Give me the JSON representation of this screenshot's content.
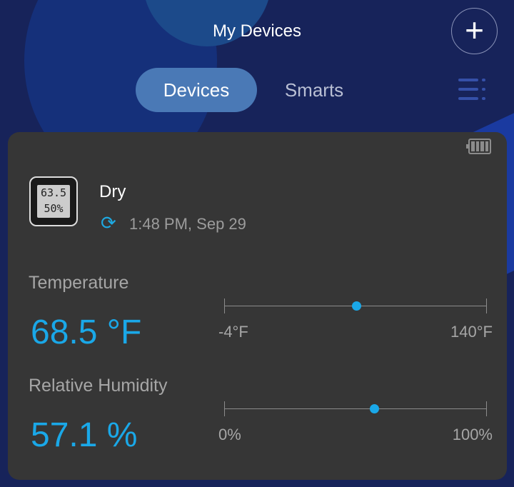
{
  "header": {
    "title": "My Devices",
    "add_icon": "plus-icon"
  },
  "tabs": [
    {
      "label": "Devices",
      "active": true
    },
    {
      "label": "Smarts",
      "active": false
    }
  ],
  "device": {
    "name": "Dry",
    "battery_icon": "battery-full-icon",
    "last_update": "1:48 PM,  Sep 29",
    "image_display": {
      "temp": "63.5",
      "hum": "50%"
    },
    "temperature": {
      "label": "Temperature",
      "value": "68.5 °F",
      "min": "-4°F",
      "max": "140°F",
      "level": 68.5,
      "range": [
        -4,
        140
      ]
    },
    "humidity": {
      "label": "Relative Humidity",
      "value": "57.1 %",
      "min": "0%",
      "max": "100%",
      "level": 57.1,
      "range": [
        0,
        100
      ]
    }
  },
  "colors": {
    "accent": "#1aa8e8",
    "tab_active": "#4a79b6",
    "card": "#363636",
    "background": "#17235a"
  }
}
